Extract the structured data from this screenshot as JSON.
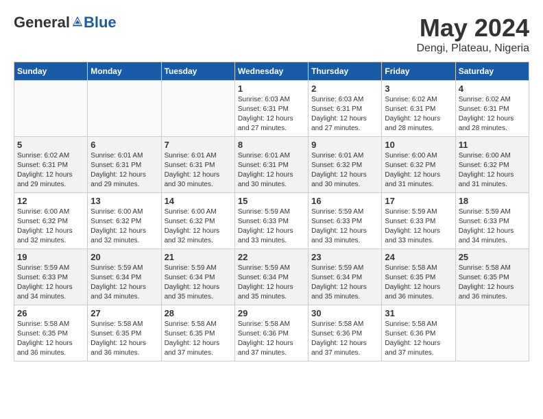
{
  "header": {
    "logo_general": "General",
    "logo_blue": "Blue",
    "month_title": "May 2024",
    "location": "Dengi, Plateau, Nigeria"
  },
  "weekdays": [
    "Sunday",
    "Monday",
    "Tuesday",
    "Wednesday",
    "Thursday",
    "Friday",
    "Saturday"
  ],
  "weeks": [
    [
      {
        "day": "",
        "info": ""
      },
      {
        "day": "",
        "info": ""
      },
      {
        "day": "",
        "info": ""
      },
      {
        "day": "1",
        "info": "Sunrise: 6:03 AM\nSunset: 6:31 PM\nDaylight: 12 hours\nand 27 minutes."
      },
      {
        "day": "2",
        "info": "Sunrise: 6:03 AM\nSunset: 6:31 PM\nDaylight: 12 hours\nand 27 minutes."
      },
      {
        "day": "3",
        "info": "Sunrise: 6:02 AM\nSunset: 6:31 PM\nDaylight: 12 hours\nand 28 minutes."
      },
      {
        "day": "4",
        "info": "Sunrise: 6:02 AM\nSunset: 6:31 PM\nDaylight: 12 hours\nand 28 minutes."
      }
    ],
    [
      {
        "day": "5",
        "info": "Sunrise: 6:02 AM\nSunset: 6:31 PM\nDaylight: 12 hours\nand 29 minutes."
      },
      {
        "day": "6",
        "info": "Sunrise: 6:01 AM\nSunset: 6:31 PM\nDaylight: 12 hours\nand 29 minutes."
      },
      {
        "day": "7",
        "info": "Sunrise: 6:01 AM\nSunset: 6:31 PM\nDaylight: 12 hours\nand 30 minutes."
      },
      {
        "day": "8",
        "info": "Sunrise: 6:01 AM\nSunset: 6:31 PM\nDaylight: 12 hours\nand 30 minutes."
      },
      {
        "day": "9",
        "info": "Sunrise: 6:01 AM\nSunset: 6:32 PM\nDaylight: 12 hours\nand 30 minutes."
      },
      {
        "day": "10",
        "info": "Sunrise: 6:00 AM\nSunset: 6:32 PM\nDaylight: 12 hours\nand 31 minutes."
      },
      {
        "day": "11",
        "info": "Sunrise: 6:00 AM\nSunset: 6:32 PM\nDaylight: 12 hours\nand 31 minutes."
      }
    ],
    [
      {
        "day": "12",
        "info": "Sunrise: 6:00 AM\nSunset: 6:32 PM\nDaylight: 12 hours\nand 32 minutes."
      },
      {
        "day": "13",
        "info": "Sunrise: 6:00 AM\nSunset: 6:32 PM\nDaylight: 12 hours\nand 32 minutes."
      },
      {
        "day": "14",
        "info": "Sunrise: 6:00 AM\nSunset: 6:32 PM\nDaylight: 12 hours\nand 32 minutes."
      },
      {
        "day": "15",
        "info": "Sunrise: 5:59 AM\nSunset: 6:33 PM\nDaylight: 12 hours\nand 33 minutes."
      },
      {
        "day": "16",
        "info": "Sunrise: 5:59 AM\nSunset: 6:33 PM\nDaylight: 12 hours\nand 33 minutes."
      },
      {
        "day": "17",
        "info": "Sunrise: 5:59 AM\nSunset: 6:33 PM\nDaylight: 12 hours\nand 33 minutes."
      },
      {
        "day": "18",
        "info": "Sunrise: 5:59 AM\nSunset: 6:33 PM\nDaylight: 12 hours\nand 34 minutes."
      }
    ],
    [
      {
        "day": "19",
        "info": "Sunrise: 5:59 AM\nSunset: 6:33 PM\nDaylight: 12 hours\nand 34 minutes."
      },
      {
        "day": "20",
        "info": "Sunrise: 5:59 AM\nSunset: 6:34 PM\nDaylight: 12 hours\nand 34 minutes."
      },
      {
        "day": "21",
        "info": "Sunrise: 5:59 AM\nSunset: 6:34 PM\nDaylight: 12 hours\nand 35 minutes."
      },
      {
        "day": "22",
        "info": "Sunrise: 5:59 AM\nSunset: 6:34 PM\nDaylight: 12 hours\nand 35 minutes."
      },
      {
        "day": "23",
        "info": "Sunrise: 5:59 AM\nSunset: 6:34 PM\nDaylight: 12 hours\nand 35 minutes."
      },
      {
        "day": "24",
        "info": "Sunrise: 5:58 AM\nSunset: 6:35 PM\nDaylight: 12 hours\nand 36 minutes."
      },
      {
        "day": "25",
        "info": "Sunrise: 5:58 AM\nSunset: 6:35 PM\nDaylight: 12 hours\nand 36 minutes."
      }
    ],
    [
      {
        "day": "26",
        "info": "Sunrise: 5:58 AM\nSunset: 6:35 PM\nDaylight: 12 hours\nand 36 minutes."
      },
      {
        "day": "27",
        "info": "Sunrise: 5:58 AM\nSunset: 6:35 PM\nDaylight: 12 hours\nand 36 minutes."
      },
      {
        "day": "28",
        "info": "Sunrise: 5:58 AM\nSunset: 6:35 PM\nDaylight: 12 hours\nand 37 minutes."
      },
      {
        "day": "29",
        "info": "Sunrise: 5:58 AM\nSunset: 6:36 PM\nDaylight: 12 hours\nand 37 minutes."
      },
      {
        "day": "30",
        "info": "Sunrise: 5:58 AM\nSunset: 6:36 PM\nDaylight: 12 hours\nand 37 minutes."
      },
      {
        "day": "31",
        "info": "Sunrise: 5:58 AM\nSunset: 6:36 PM\nDaylight: 12 hours\nand 37 minutes."
      },
      {
        "day": "",
        "info": ""
      }
    ]
  ]
}
